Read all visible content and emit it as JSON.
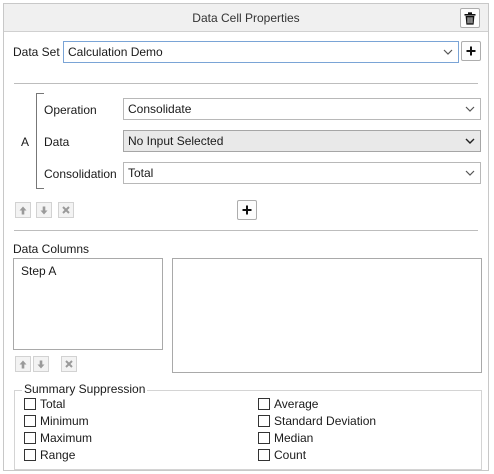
{
  "panel": {
    "title": "Data Cell Properties"
  },
  "icons": {
    "delete": "trash-icon",
    "add": "plus-icon",
    "chevron": "chevron-down-icon",
    "up": "arrow-up-icon",
    "down": "arrow-down-icon",
    "remove": "x-icon"
  },
  "dataset": {
    "label": "Data Set",
    "value": "Calculation Demo"
  },
  "step": {
    "letter": "A",
    "operation": {
      "label": "Operation",
      "value": "Consolidate"
    },
    "data": {
      "label": "Data",
      "value": "No Input Selected"
    },
    "consolidation": {
      "label": "Consolidation",
      "value": "Total"
    }
  },
  "columns": {
    "label": "Data Columns",
    "items": [
      "Step A"
    ]
  },
  "suppression": {
    "title": "Summary Suppression",
    "left": [
      "Total",
      "Minimum",
      "Maximum",
      "Range"
    ],
    "right": [
      "Average",
      "Standard Deviation",
      "Median",
      "Count"
    ]
  }
}
